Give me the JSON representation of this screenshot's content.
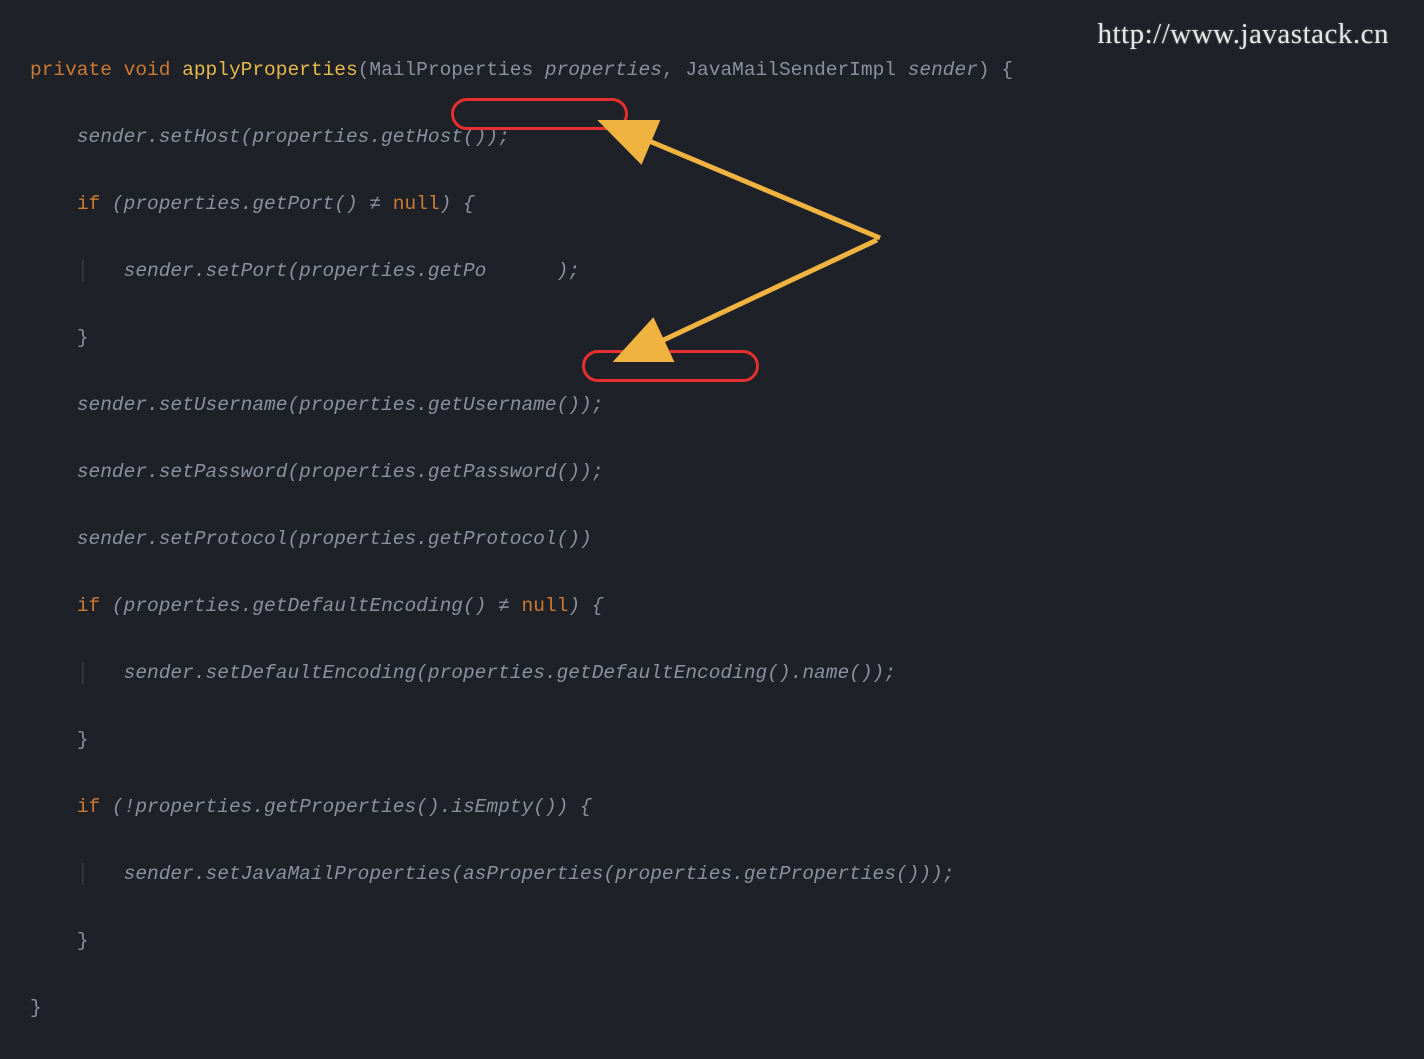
{
  "watermark": "http://www.javastack.cn",
  "code": {
    "line1": {
      "kw_private": "private",
      "kw_void": "void",
      "method": "applyProperties",
      "paren_open": "(",
      "param1_type": "MailProperties",
      "param1_name": "properties",
      "comma": ",",
      "param2_type": "JavaMailSenderImpl",
      "param2_name": "sender",
      "paren_close": ")",
      "brace": "{"
    },
    "line2": {
      "text": "sender.setHost(properties.getHost());"
    },
    "line3": {
      "kw_if": "if",
      "cond_open": "(properties.getPort() ",
      "neq": "≠",
      "kw_null": "null",
      "cond_close": ") {"
    },
    "line4": {
      "text": "sender.setPort(properties.getPo",
      "text_after": ");"
    },
    "line5": {
      "brace": "}"
    },
    "line6": {
      "text": "sender.setUsername(properties.getUsername());"
    },
    "line7": {
      "text": "sender.setPassword(properties.getPassword());"
    },
    "line8": {
      "text": "sender.setProtocol(properties.getProtocol())"
    },
    "line9": {
      "kw_if": "if",
      "cond_open": "(properties.getDefaultEncoding() ",
      "neq": "≠",
      "kw_null": "null",
      "cond_close": ") {"
    },
    "line10": {
      "text": "sender.setDefaultEncoding(properties.getDefaultEncoding().name());"
    },
    "line11": {
      "brace": "}"
    },
    "line12": {
      "kw_if": "if",
      "cond": "(!properties.getProperties().isEmpty()) {"
    },
    "line13": {
      "text": "sender.setJavaMailProperties(asProperties(properties.getProperties()));"
    },
    "line14": {
      "brace": "}"
    },
    "line15": {
      "brace": "}"
    }
  }
}
